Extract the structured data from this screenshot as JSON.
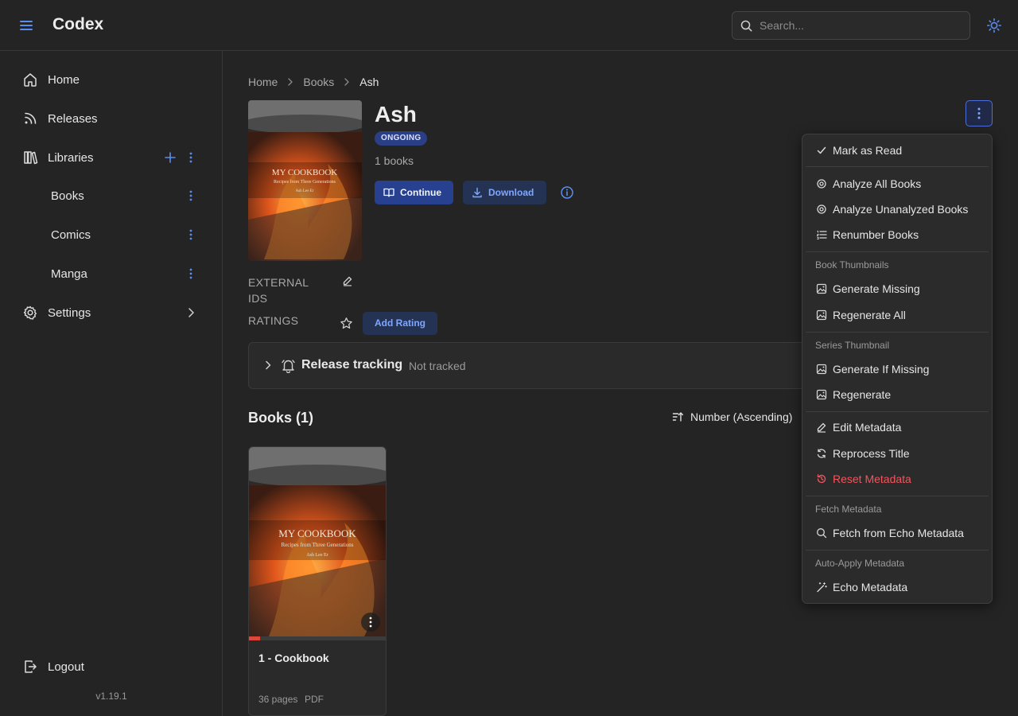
{
  "app": {
    "title": "Codex",
    "version": "v1.19.1"
  },
  "search": {
    "placeholder": "Search..."
  },
  "sidebar": {
    "home": "Home",
    "releases": "Releases",
    "libraries": "Libraries",
    "library_items": [
      "Books",
      "Comics",
      "Manga"
    ],
    "settings": "Settings",
    "logout": "Logout"
  },
  "breadcrumb": [
    "Home",
    "Books",
    "Ash"
  ],
  "series": {
    "title": "Ash",
    "status": "ONGOING",
    "book_count": "1 books",
    "continue_label": "Continue",
    "download_label": "Download",
    "cover_title": "MY COOKBOOK",
    "cover_subtitle": "Recipes from Three Generations",
    "cover_author": "Ash Lee Er"
  },
  "metadata": {
    "external_ids_line1": "EXTERNAL",
    "external_ids_line2": "IDS",
    "ratings": "RATINGS",
    "add_rating": "Add Rating"
  },
  "release_tracking": {
    "title": "Release tracking",
    "status": "Not tracked"
  },
  "books_section": {
    "heading": "Books (1)",
    "sort_label": "Number (Ascending)"
  },
  "books": [
    {
      "title": "1 - Cookbook",
      "pages": "36 pages",
      "format": "PDF",
      "progress": 0.08
    }
  ],
  "menu": {
    "mark_as_read": "Mark as Read",
    "analyze_all": "Analyze All Books",
    "analyze_unanalyzed": "Analyze Unanalyzed Books",
    "renumber": "Renumber Books",
    "section_book_thumbnails": "Book Thumbnails",
    "generate_missing": "Generate Missing",
    "regenerate_all": "Regenerate All",
    "section_series_thumbnail": "Series Thumbnail",
    "generate_if_missing": "Generate If Missing",
    "regenerate": "Regenerate",
    "edit_metadata": "Edit Metadata",
    "reprocess_title": "Reprocess Title",
    "reset_metadata": "Reset Metadata",
    "section_fetch_metadata": "Fetch Metadata",
    "fetch_echo": "Fetch from Echo Metadata",
    "section_auto_apply": "Auto-Apply Metadata",
    "echo_metadata": "Echo Metadata"
  },
  "colors": {
    "accent": "#7fa7ff",
    "primary": "#27408f",
    "danger": "#f2545b",
    "badge": "#2b3f86"
  }
}
